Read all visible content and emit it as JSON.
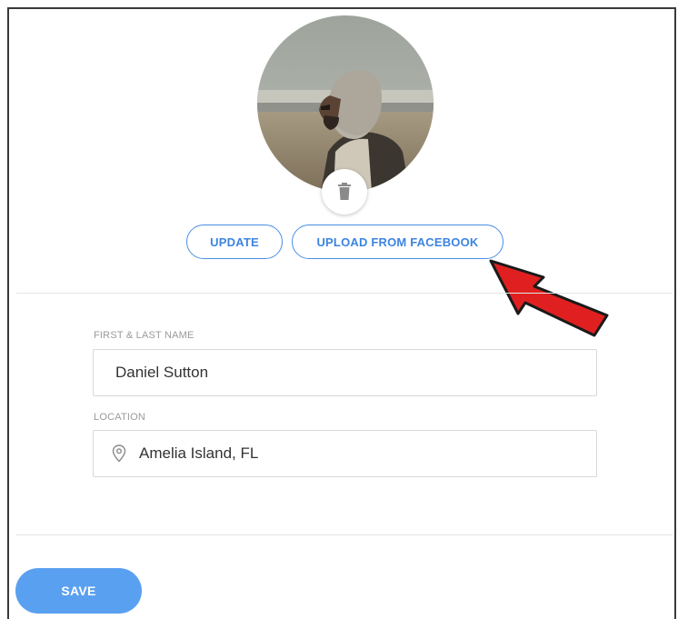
{
  "profile": {
    "update_label": "UPDATE",
    "facebook_label": "UPLOAD FROM FACEBOOK",
    "avatar_icon": "profile-photo",
    "delete_icon": "trash-icon"
  },
  "form": {
    "name_label": "FIRST & LAST NAME",
    "name_value": "Daniel Sutton",
    "location_label": "LOCATION",
    "location_value": "Amelia Island, FL",
    "location_icon": "location-pin-icon"
  },
  "footer": {
    "save_label": "SAVE"
  },
  "colors": {
    "accent": "#4a8fe7",
    "save_button": "#5aa0f0",
    "annotation_arrow": "#e02020"
  }
}
